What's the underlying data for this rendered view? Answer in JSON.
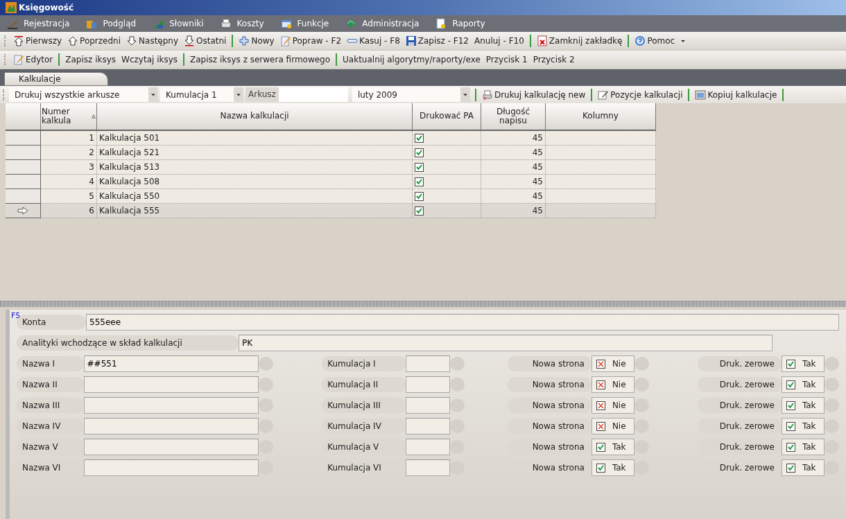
{
  "window": {
    "title": "Księgowość"
  },
  "menu": [
    "Rejestracja",
    "Podgląd",
    "Słowniki",
    "Koszty",
    "Funkcje",
    "Administracja",
    "Raporty"
  ],
  "toolbar_1": [
    [
      "Pierwszy",
      "Poprzedni",
      "Następny",
      "Ostatni"
    ],
    [
      "Nowy",
      "Popraw - F2",
      "Kasuj - F8",
      "Zapisz - F12",
      "Anuluj - F10"
    ],
    [
      "Zamknij zakładkę"
    ],
    [
      "Pomoc"
    ]
  ],
  "toolbar_2": [
    [
      "Edytor"
    ],
    [
      "Zapisz iksys",
      "Wczytaj iksys"
    ],
    [
      "Zapisz iksys z serwera firmowego"
    ],
    [
      "Uaktualnij algorytmy/raporty/exe",
      "Przycisk 1",
      "Przycisk 2"
    ]
  ],
  "tabs": [
    {
      "label": "Kalkulacje",
      "selected": true
    }
  ],
  "filter_bar": {
    "print_mode": "Drukuj wszystkie arkusze",
    "cumulation": "Kumulacja 1",
    "sheet_label": "Arkusz",
    "month": "luty 2009",
    "actions": [
      "Drukuj kalkulację new",
      "Pozycje kalkulacji",
      "Kopiuj kalkulacje"
    ]
  },
  "table": {
    "columns": [
      "Numer kalkula",
      "Nazwa kalkulacji",
      "Drukować PA",
      "Długość napisu",
      "Kolumny"
    ],
    "rows": [
      {
        "number": "1",
        "name": "Kalkulacja 501",
        "print_pa": true,
        "length": "45",
        "selected": false
      },
      {
        "number": "2",
        "name": "Kalkulacja 521",
        "print_pa": true,
        "length": "45",
        "selected": false
      },
      {
        "number": "3",
        "name": "Kalkulacja 513",
        "print_pa": true,
        "length": "45",
        "selected": false
      },
      {
        "number": "4",
        "name": "Kalkulacja 508",
        "print_pa": true,
        "length": "45",
        "selected": false
      },
      {
        "number": "5",
        "name": "Kalkulacja 550",
        "print_pa": true,
        "length": "45",
        "selected": false
      },
      {
        "number": "6",
        "name": "Kalkulacja 555",
        "print_pa": true,
        "length": "45",
        "selected": true
      }
    ]
  },
  "form": {
    "hotkey": "F5",
    "konta_label": "Konta",
    "konta": "555eee",
    "analytics_label": "Analityki wchodzące w skład kalkulacji",
    "analytics": "PK",
    "rows": [
      {
        "name_label": "Nazwa I",
        "name": "##551",
        "cum_label": "Kumulacja I",
        "new_page_label": "Nowa strona",
        "new_page": {
          "checked": false,
          "text": "Nie"
        },
        "zeros_label": "Druk. zerowe",
        "zeros": {
          "checked": true,
          "text": "Tak"
        }
      },
      {
        "name_label": "Nazwa II",
        "cum_label": "Kumulacja II",
        "new_page_label": "Nowa strona",
        "new_page": {
          "checked": false,
          "text": "Nie"
        },
        "zeros_label": "Druk. zerowe",
        "zeros": {
          "checked": true,
          "text": "Tak"
        }
      },
      {
        "name_label": "Nazwa III",
        "cum_label": "Kumulacja III",
        "new_page_label": "Nowa strona",
        "new_page": {
          "checked": false,
          "text": "Nie"
        },
        "zeros_label": "Druk. zerowe",
        "zeros": {
          "checked": true,
          "text": "Tak"
        }
      },
      {
        "name_label": "Nazwa IV",
        "cum_label": "Kumulacja IV",
        "new_page_label": "Nowa strona",
        "new_page": {
          "checked": false,
          "text": "Nie"
        },
        "zeros_label": "Druk. zerowe",
        "zeros": {
          "checked": true,
          "text": "Tak"
        }
      },
      {
        "name_label": "Nazwa V",
        "cum_label": "Kumulacja V",
        "new_page_label": "Nowa strona",
        "new_page": {
          "checked": true,
          "text": "Tak"
        },
        "zeros_label": "Druk. zerowe",
        "zeros": {
          "checked": true,
          "text": "Tak"
        }
      },
      {
        "name_label": "Nazwa VI",
        "cum_label": "Kumulacja VI",
        "new_page_label": "Nowa strona",
        "new_page": {
          "checked": true,
          "text": "Tak"
        },
        "zeros_label": "Druk. zerowe",
        "zeros": {
          "checked": true,
          "text": "Tak"
        }
      }
    ]
  }
}
